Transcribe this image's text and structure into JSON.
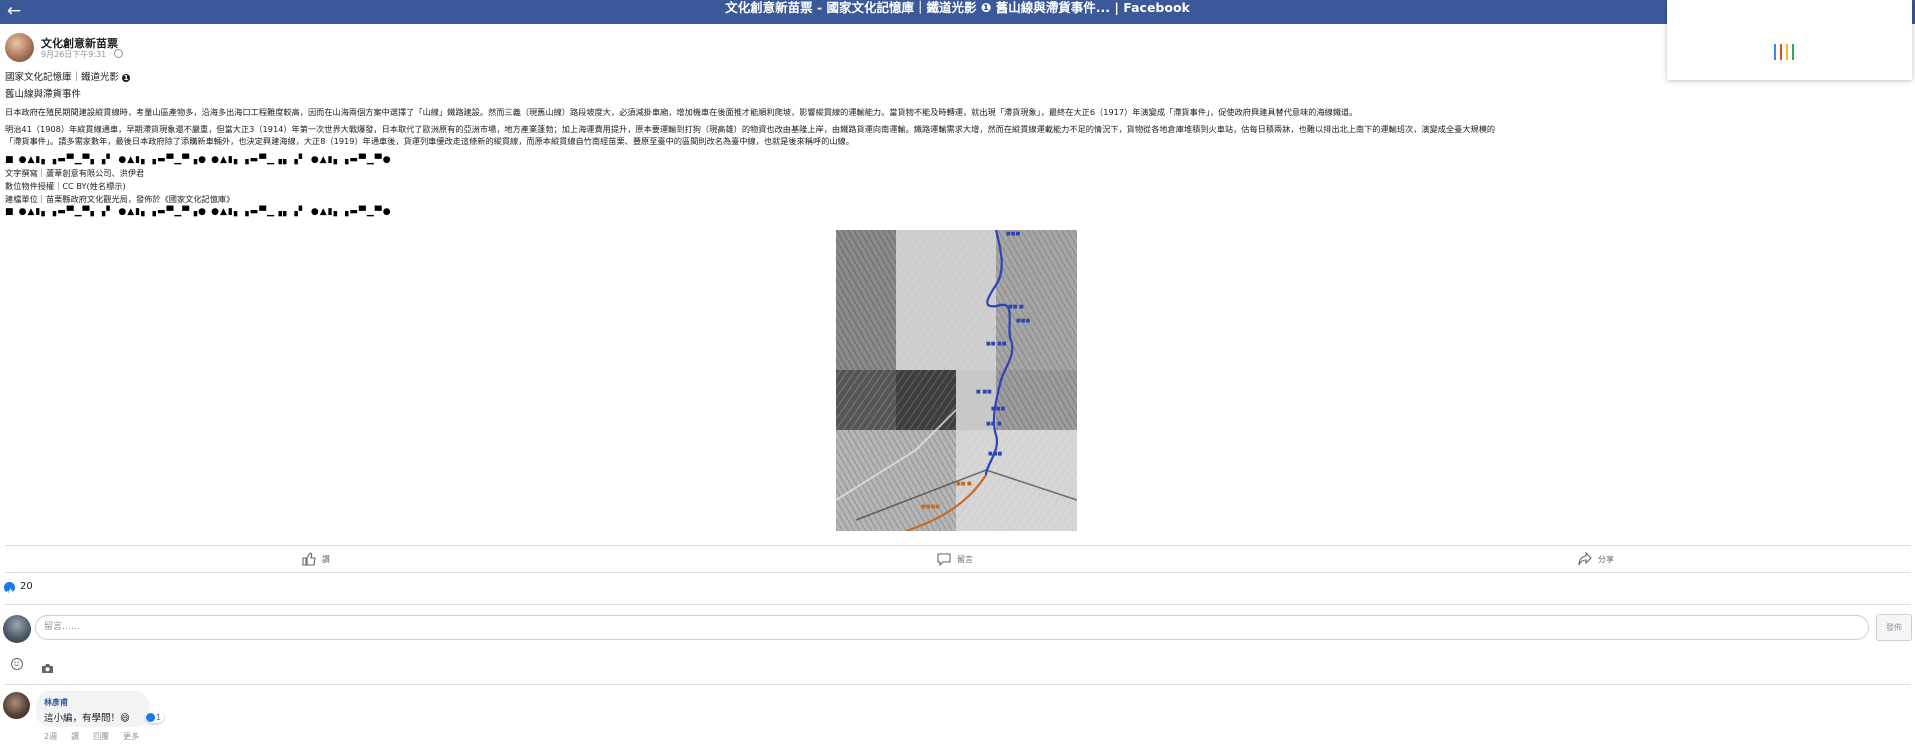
{
  "topbar": {
    "back_icon": "back-arrow-icon",
    "title": "文化創意新苗票 - 國家文化記憶庫｜鐵道光影 ❶ 舊山線與滯貨事件... | Facebook"
  },
  "post": {
    "page_name": "文化創意新苗票",
    "time": "9月26日下午9:31 ·",
    "header_line": "國家文化記憶庫｜鐵道光影",
    "subtitle": "舊山線與滯貨事件",
    "paragraph_1": "日本政府在殖民期間建設縱貫線時，考量山區產物多，沿海多出海口工程難度較高，因而在山海兩個方案中選擇了「山線」鐵路建設。然而三義（現舊山線）路段坡度大，必須減掛車廂，增加機車在後面推才能順利爬坡，影響縱貫線的運輸能力。當貨物不能及時轉運，就出現「滯貨現象」，最終在大正6（1917）年演變成「滯貨事件」，促使政府興建具替代意味的海線鐵道。",
    "paragraph_2a": "明治41（1908）年縱貫線通車，早期滯貨現象還不嚴重，但當大正3（1914）年第一次世界大戰爆發，日本取代了歐洲原有的亞洲市場，地方產業蓬勃；加上海運費用提升，原本要運輸到打狗（現高雄）的物資也改由基隆上岸，由鐵路貨運向南運輸。鐵路運輸需求大增，然而在縱貫線運載能力不足的情況下，貨物從各地倉庫堆積到火車站，估每日積兩牀，也難以排出北上南下的運輸班次，演變成全臺大規模的",
    "paragraph_2b": "「滯貨事件」。請多需家數年，最後日本政府除了添購新車輛外，也決定興建海線，大正8（1919）年通車後，貨運列車優改走這條新的縱貫線，而原本縱貫線自竹南經苗栗、豐原至臺中的區間則改名為臺中線，也就是後來稱呼的山線。",
    "credits": [
      "文字撰寫｜蘆葦創意有限公司、洪伊君",
      "數位物件授權｜CC BY(姓名標示)",
      "建檔單位｜苗栗縣政府文化觀光局，發佈於《國家文化記憶庫》"
    ],
    "glyph_row": "■ ●▲▮▖▗▬▀▁▀▖▗▘ ●▲▮▖▗▬▀▁▀▗● ●▲▮▖▗▬▀▁▗▖▗▘ ●▲▮▖▗▬▀▁▀●",
    "map": {
      "alt": "舊山線衛星地圖",
      "route_color": "#2d44b5",
      "lower_route_color": "#c96a24"
    }
  },
  "actions": {
    "like": "讚",
    "comment": "留言",
    "share": "分享"
  },
  "reactions": {
    "count": "20"
  },
  "composer": {
    "placeholder": "留言……",
    "post_button": "發佈"
  },
  "comment": {
    "name": "林彥甫",
    "text": "這小編，有學問！😄",
    "reaction_count": "1",
    "actions": [
      "2週",
      "讚",
      "回覆",
      "更多"
    ]
  },
  "colors": {
    "topbar": "#3b5998",
    "link": "#385898",
    "loading_bars": [
      "#4285f4",
      "#ea4335",
      "#fbbc05",
      "#34a853"
    ]
  }
}
